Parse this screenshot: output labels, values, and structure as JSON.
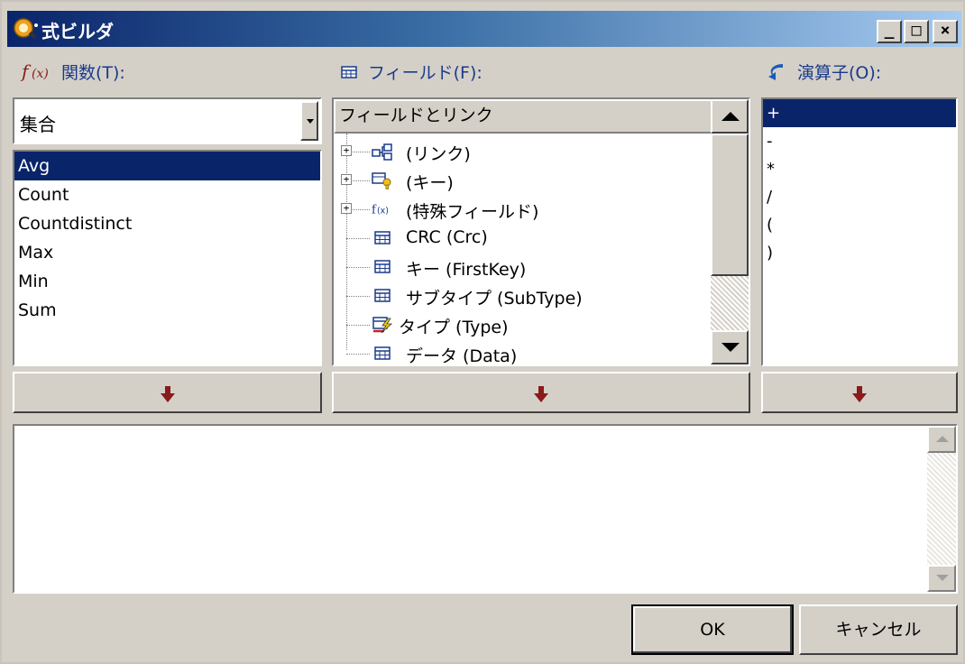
{
  "window": {
    "title": "式ビルダ",
    "controls": {
      "minimize": "_",
      "maximize": "□",
      "close": "×"
    }
  },
  "functions": {
    "label": "関数(T):",
    "category": "集合",
    "items": [
      "Avg",
      "Count",
      "Countdistinct",
      "Max",
      "Min",
      "Sum"
    ],
    "selected": "Avg"
  },
  "fields": {
    "label": "フィールド(F):",
    "column_header": "フィールドとリンク",
    "tree": [
      {
        "label": "(リンク)",
        "expandable": true,
        "icon": "link-icon"
      },
      {
        "label": "(キー)",
        "expandable": true,
        "icon": "key-icon"
      },
      {
        "label": "(特殊フィールド)",
        "expandable": true,
        "icon": "function-icon"
      },
      {
        "label": "CRC (Crc)",
        "expandable": false,
        "icon": "field-icon"
      },
      {
        "label": "キー (FirstKey)",
        "expandable": false,
        "icon": "field-icon"
      },
      {
        "label": "サブタイプ (SubType)",
        "expandable": false,
        "icon": "field-icon"
      },
      {
        "label": "タイプ (Type)",
        "expandable": false,
        "icon": "typed-field-icon"
      },
      {
        "label": "データ (Data)",
        "expandable": false,
        "icon": "field-icon"
      }
    ]
  },
  "operators": {
    "label": "演算子(O):",
    "items": [
      "+",
      "-",
      "*",
      "/",
      "(",
      ")"
    ],
    "selected": "+"
  },
  "formula": {
    "value": ""
  },
  "buttons": {
    "ok": "OK",
    "cancel": "キャンセル"
  },
  "colors": {
    "selection": "#0a246a",
    "label_text": "#1a3a8a",
    "insert_arrow": "#8b1a1a",
    "face": "#d4d0c8"
  }
}
